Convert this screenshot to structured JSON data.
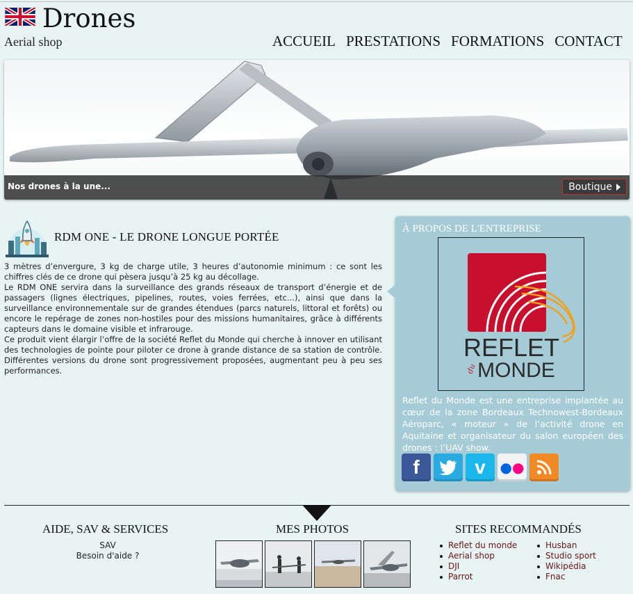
{
  "header": {
    "title": "Drones",
    "subtitle": "Aerial shop",
    "nav": [
      "ACCUEIL",
      "PRESTATIONS",
      "FORMATIONS",
      "CONTACT"
    ]
  },
  "banner": {
    "caption": "Nos drones à la une...",
    "shop_label": "Boutique"
  },
  "article": {
    "title": "RDM ONE - LE DRONE LONGUE PORTÉE",
    "paragraphs": [
      "3 mètres d’envergure, 3 kg de charge utile, 3 heures d’autonomie minimum : ce sont les chiffres clés de ce drone qui pèsera jusqu’à 25 kg au décollage.",
      "Le RDM ONE servira dans la surveillance des grands réseaux de transport d’énergie et de passagers (lignes électriques, pipelines, routes, voies ferrées, etc...), ainsi que dans la surveillance environnementale sur de grandes étendues (parcs naturels, littoral et forêts) ou encore le repérage de zones non-hostiles pour des missions humanitaires, grâce à différents capteurs dans le domaine visible et infrarouge.",
      "Ce produit vient élargir l’offre de la société Reflet du Monde qui cherche à innover en utilisant des technologies de pointe pour piloter ce drone à grande distance de sa station de contrôle. Différentes versions du drone sont progressivement proposées, augmentant peu à peu ses performances."
    ]
  },
  "about": {
    "title": "À PROPOS DE L'ENTREPRISE",
    "logo_text_1": "REFLET",
    "logo_text_2": "du",
    "logo_text_3": "MONDE",
    "text": "Reflet du Monde est une entreprise implantée au cœur de la zone Bordeaux Technowest-Bordeaux Aéroparc, « moteur » de l’activité drone en Aquitaine et organisateur du salon européen des drones : l’UAV show.",
    "socials": [
      {
        "name": "facebook-icon",
        "glyph": "f",
        "color": "#3b5998"
      },
      {
        "name": "twitter-icon",
        "glyph": "t",
        "color": "#29aae1"
      },
      {
        "name": "vimeo-icon",
        "glyph": "v",
        "color": "#1ab7ea"
      },
      {
        "name": "flickr-icon",
        "glyph": "••",
        "color": "#f3f3f3"
      },
      {
        "name": "rss-icon",
        "glyph": "))",
        "color": "#f08a24"
      }
    ]
  },
  "footer": {
    "help_title": "AIDE, SAV & SERVICES",
    "help_links": [
      "SAV",
      "Besoin d'aide ?"
    ],
    "photos_title": "MES PHOTOS",
    "sites_title": "SITES RECOMMANDÉS",
    "sites_col1": [
      "Reflet du monde",
      "Aerial shop",
      "DJI",
      "Parrot"
    ],
    "sites_col2": [
      "Husban",
      "Studio sport",
      "Wikipédia",
      "Fnac"
    ]
  },
  "colors": {
    "background": "#e8f4f4",
    "about_panel": "#a4cbd6",
    "logo_red": "#c8102e",
    "logo_orange": "#f0a020",
    "link_color": "#6a1414"
  }
}
